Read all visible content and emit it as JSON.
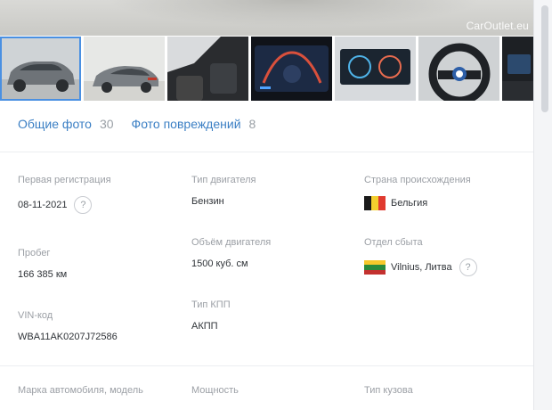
{
  "watermark": "CarOutlet.eu",
  "gallery": {
    "tabs": [
      {
        "label": "Общие фото",
        "count": "30"
      },
      {
        "label": "Фото повреждений",
        "count": "8"
      }
    ]
  },
  "specs": {
    "first_registration": {
      "label": "Первая регистрация",
      "value": "08-11-2021",
      "help": "?"
    },
    "engine_type": {
      "label": "Тип двигателя",
      "value": "Бензин"
    },
    "origin_country": {
      "label": "Страна происхождения",
      "value": "Бельгия"
    },
    "mileage": {
      "label": "Пробег",
      "value": "166 385 км"
    },
    "engine_volume": {
      "label": "Объём двигателя",
      "value": "1500 куб. см"
    },
    "sales_office": {
      "label": "Отдел сбыта",
      "value": "Vilnius, Литва",
      "help": "?"
    },
    "vin": {
      "label": "VIN-код",
      "value": "WBA11AK0207J72586"
    },
    "transmission": {
      "label": "Тип КПП",
      "value": "АКПП"
    },
    "make_model": {
      "label": "Марка автомобиля, модель"
    },
    "power": {
      "label": "Мощность"
    },
    "body_type": {
      "label": "Тип кузова"
    }
  },
  "flags": {
    "belgium": [
      "#1a1a1a",
      "#f3cf2e",
      "#e03a2f"
    ],
    "lithuania": [
      "#f6c82b",
      "#2a8a3c",
      "#c3312f"
    ]
  }
}
